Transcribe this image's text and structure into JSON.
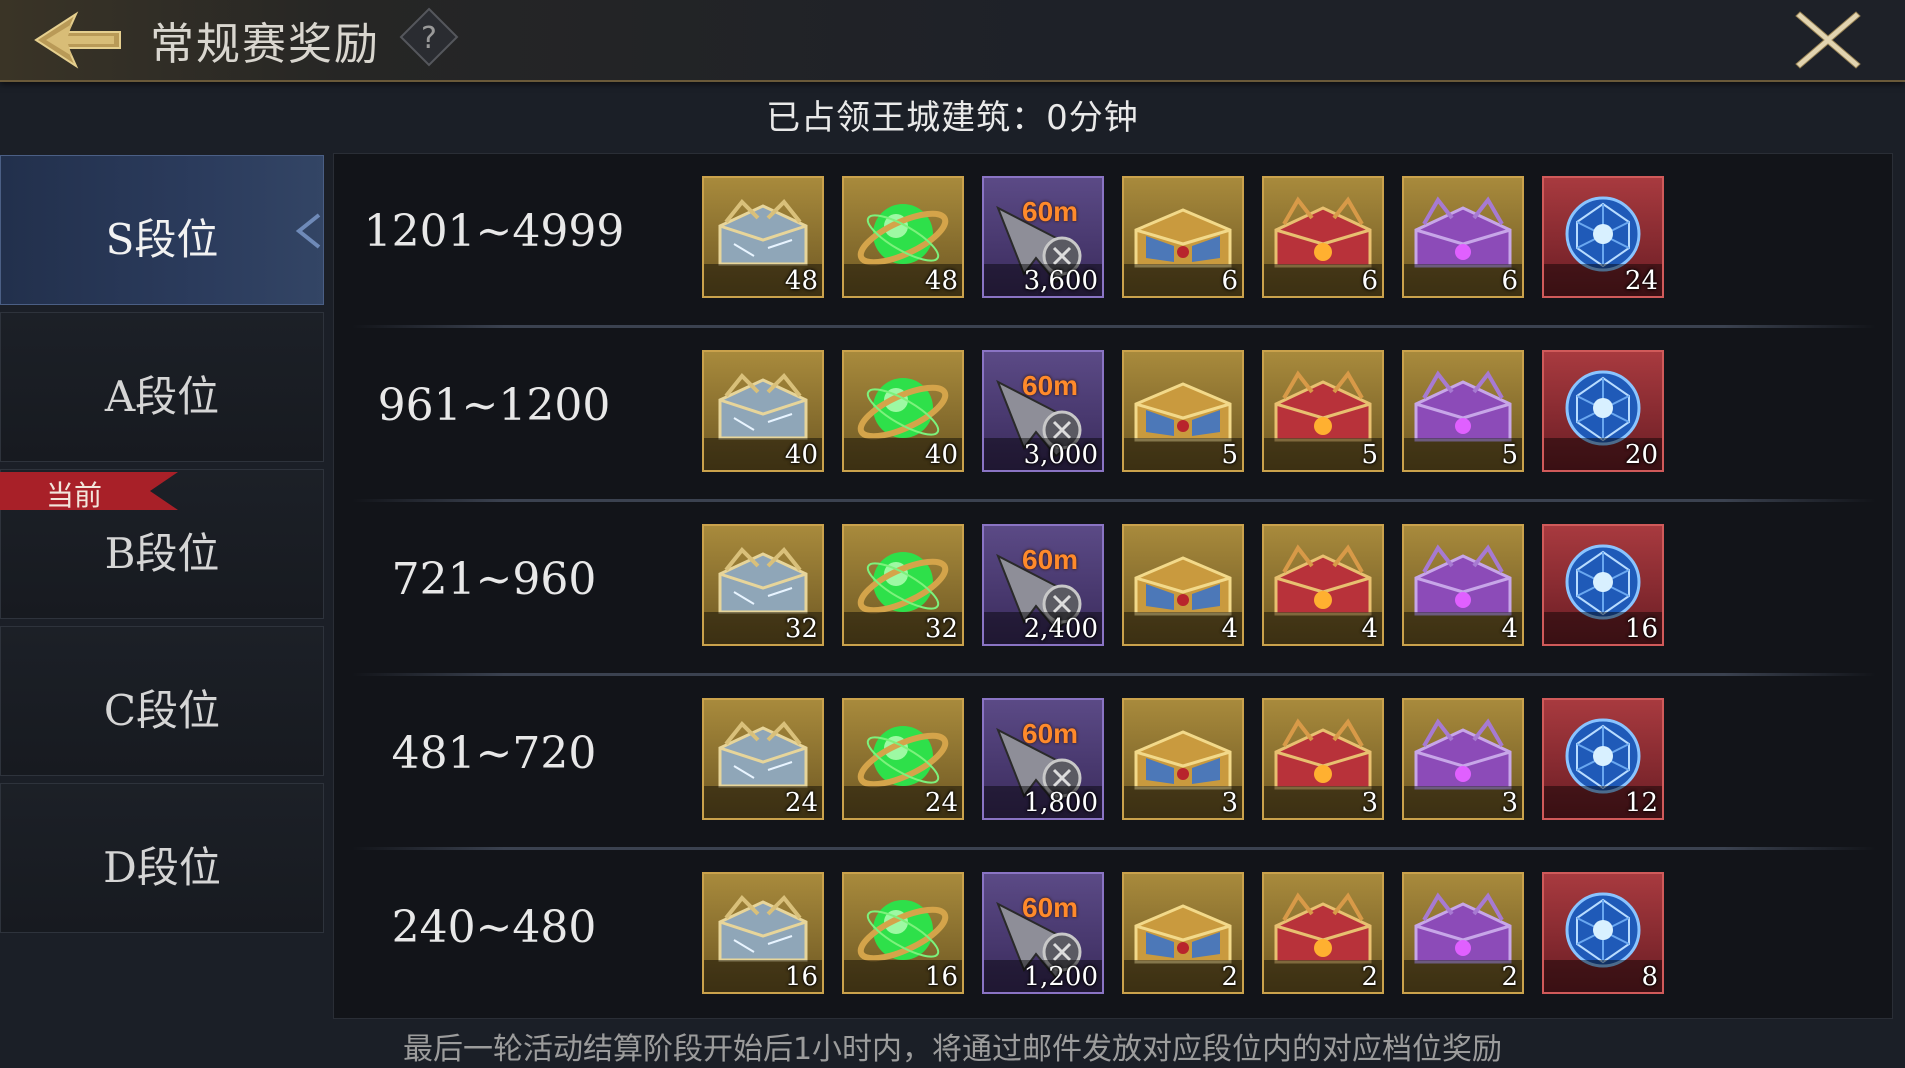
{
  "header": {
    "title": "常规赛奖励",
    "back_icon": "back-arrow-icon",
    "help_label": "?",
    "close_icon": "close-x-icon"
  },
  "occupy_status": "已占领王城建筑：0分钟",
  "sidebar": {
    "tiers": [
      {
        "label": "S段位",
        "active": true,
        "current": false
      },
      {
        "label": "A段位",
        "active": false,
        "current": false
      },
      {
        "label": "B段位",
        "active": false,
        "current": true
      },
      {
        "label": "C段位",
        "active": false,
        "current": false
      },
      {
        "label": "D段位",
        "active": false,
        "current": false
      }
    ],
    "current_badge": "当前"
  },
  "reward_items": [
    {
      "icon": "silver-chest-icon",
      "frame": "gold"
    },
    {
      "icon": "green-orb-icon",
      "frame": "gold"
    },
    {
      "icon": "speedup-60m-icon",
      "frame": "purple",
      "tag": "60m"
    },
    {
      "icon": "gold-chest-icon",
      "frame": "gold"
    },
    {
      "icon": "red-chest-icon",
      "frame": "gold"
    },
    {
      "icon": "purple-chest-icon",
      "frame": "gold"
    },
    {
      "icon": "blue-crystal-icon",
      "frame": "red"
    }
  ],
  "rows": [
    {
      "range": "1201~4999",
      "quantities": [
        "48",
        "48",
        "3,600",
        "6",
        "6",
        "6",
        "24"
      ]
    },
    {
      "range": "961~1200",
      "quantities": [
        "40",
        "40",
        "3,000",
        "5",
        "5",
        "5",
        "20"
      ]
    },
    {
      "range": "721~960",
      "quantities": [
        "32",
        "32",
        "2,400",
        "4",
        "4",
        "4",
        "16"
      ]
    },
    {
      "range": "481~720",
      "quantities": [
        "24",
        "24",
        "1,800",
        "3",
        "3",
        "3",
        "12"
      ]
    },
    {
      "range": "240~480",
      "quantities": [
        "16",
        "16",
        "1,200",
        "2",
        "2",
        "2",
        "8"
      ]
    }
  ],
  "footer_note": "最后一轮活动结算阶段开始后1小时内，将通过邮件发放对应段位内的对应档位奖励",
  "colors": {
    "active_tab": "#2b3b5c",
    "current_badge": "#b0242b",
    "gold_frame": "#caa24c",
    "red_frame": "#d05a5a",
    "purple_frame": "#8a74c4"
  }
}
